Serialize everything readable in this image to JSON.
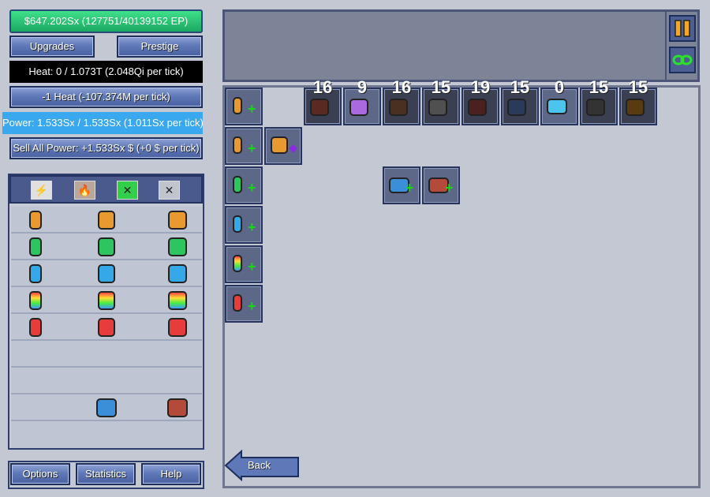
{
  "header": {
    "money": "$647.202Sx (127751/40139152 EP)",
    "heat": "Heat: 0 / 1.073T (2.048Qi per tick)",
    "power": "Power: 1.533Sx / 1.533Sx (1.011Sx per tick)"
  },
  "buttons": {
    "upgrades": "Upgrades",
    "prestige": "Prestige",
    "reduce_heat": "-1 Heat (-107.374M per tick)",
    "sell_power": "Sell All Power: +1.533Sx $ (+0 $ per tick)",
    "options": "Options",
    "statistics": "Statistics",
    "help": "Help",
    "back": "Back"
  },
  "tabs": [
    {
      "icon": "power-tab-icon"
    },
    {
      "icon": "heat-tab-icon"
    },
    {
      "icon": "experimental-tab-icon"
    },
    {
      "icon": "arcane-tab-icon"
    }
  ],
  "upgrade_counts": [
    "16",
    "9",
    "16",
    "15",
    "19",
    "15",
    "0",
    "15",
    "15"
  ],
  "colors": {
    "money_green": "#2bd07a",
    "power_blue": "#3aa8ef",
    "button_blue": "#5f78b8",
    "plus_green": "#15d815"
  }
}
